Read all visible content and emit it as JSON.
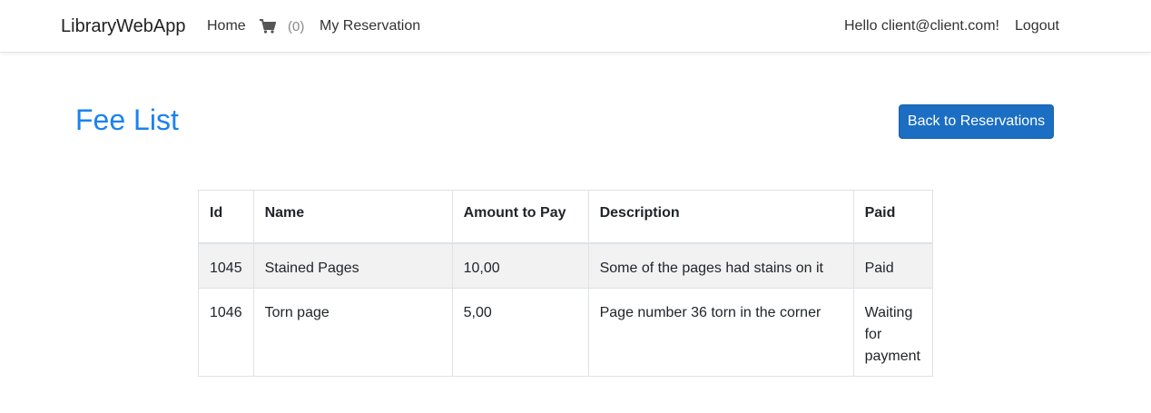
{
  "navbar": {
    "brand": "LibraryWebApp",
    "home": "Home",
    "cart_icon": "shopping-cart-icon",
    "cart_count": "(0)",
    "reservation": "My Reservation",
    "greeting": "Hello client@client.com!",
    "logout": "Logout"
  },
  "page": {
    "title": "Fee List",
    "back_button": "Back to Reservations"
  },
  "table": {
    "headers": [
      "Id",
      "Name",
      "Amount to Pay",
      "Description",
      "Paid"
    ],
    "rows": [
      [
        "1045",
        "Stained Pages",
        "10,00",
        "Some of the pages had stains on it",
        "Paid"
      ],
      [
        "1046",
        "Torn page",
        "5,00",
        "Page number 36 torn in the corner",
        "Waiting for payment"
      ]
    ]
  },
  "colors": {
    "title": "#1a82f0",
    "button": "#1b6ec2",
    "striped_row": "#f2f2f2"
  }
}
